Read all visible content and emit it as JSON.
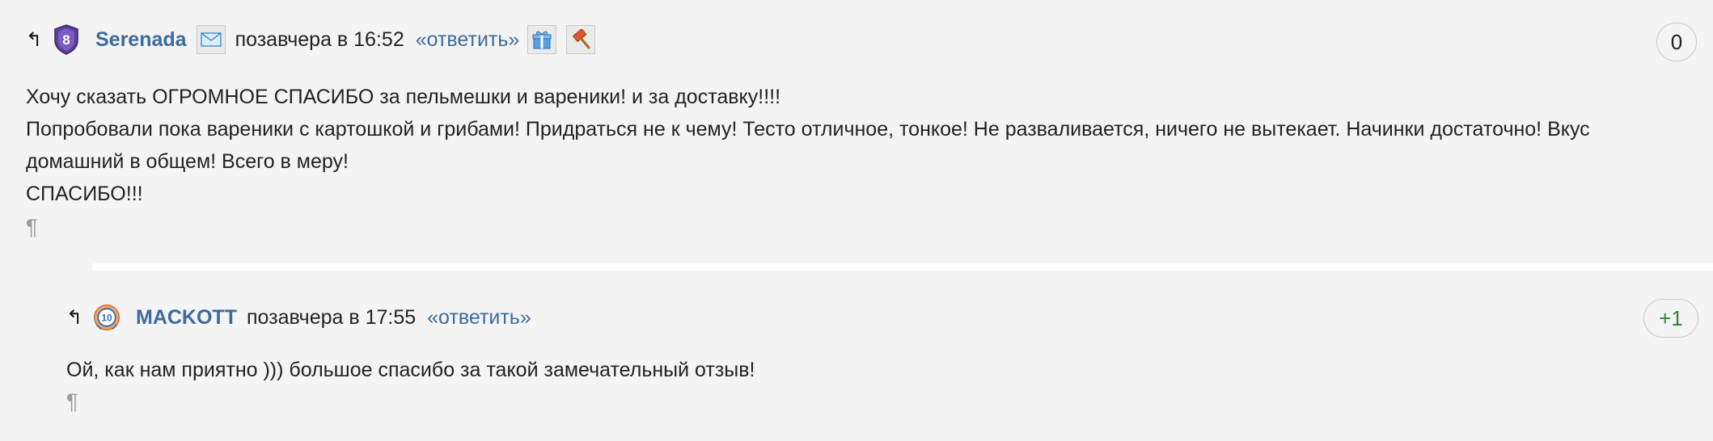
{
  "comments": [
    {
      "parent_link": "↰",
      "username": "Serenada",
      "date": "позавчера в 16:52",
      "reply_label": "«ответить»",
      "score": "0",
      "body": [
        "Хочу сказать ОГРОМНОЕ СПАСИБО за пельмешки и вареники! и за доставку!!!!",
        "Попробовали пока вареники с картошкой и грибами! Придраться не к чему! Тесто отличное, тонкое! Не разваливается, ничего не вытекает. Начинки достаточно! Вкус домашний в общем! Всего в меру!",
        "СПАСИБО!!!"
      ],
      "permalink": "¶",
      "icons": [
        "rank-8-badge-icon",
        "envelope-icon",
        "gift-icon",
        "gavel-icon"
      ],
      "avatar_badge": "8"
    },
    {
      "parent_link": "↰",
      "username": "MACKOTT",
      "date": "позавчера в 17:55",
      "reply_label": "«ответить»",
      "score": "+1",
      "body": [
        "Ой, как нам приятно ))) большое спасибо за такой замечательный отзыв!"
      ],
      "permalink": "¶",
      "icons": [
        "rank-10-badge-icon"
      ],
      "avatar_badge": "10"
    }
  ],
  "colors": {
    "background": "#f4f4f4",
    "link": "#3d6a9e",
    "positive_score": "#2e8b2e",
    "divider": "#ffffff"
  }
}
